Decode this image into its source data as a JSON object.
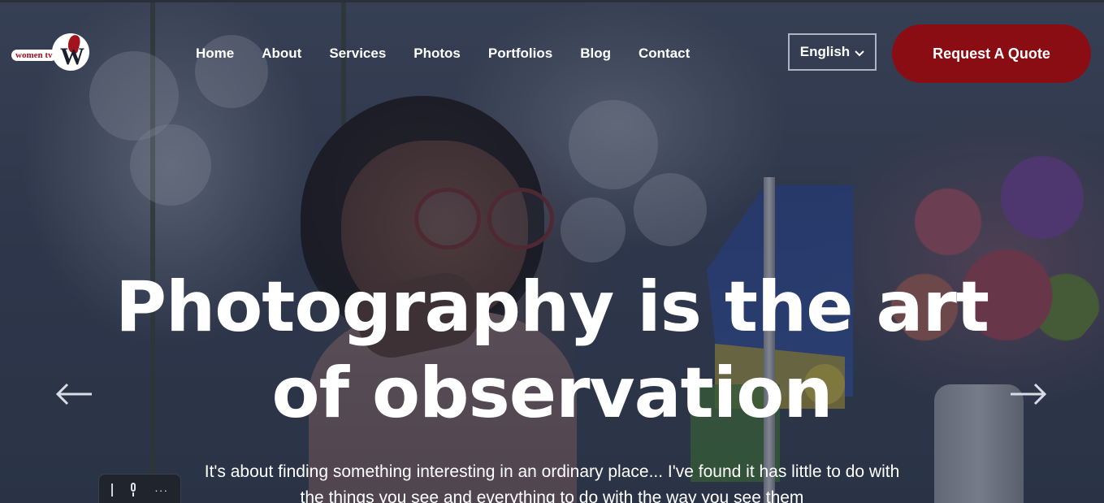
{
  "brand": {
    "logo_text": "women tv",
    "logo_letter": "W"
  },
  "nav": {
    "items": [
      {
        "label": "Home"
      },
      {
        "label": "About"
      },
      {
        "label": "Services"
      },
      {
        "label": "Photos"
      },
      {
        "label": "Portfolios"
      },
      {
        "label": "Blog"
      },
      {
        "label": "Contact"
      }
    ]
  },
  "language": {
    "selected": "English",
    "icon": "chevron-down-icon"
  },
  "cta": {
    "label": "Request A Quote",
    "color": "#8b0d14"
  },
  "hero": {
    "headline_line1": "Photography is the art",
    "headline_line2": "of observation",
    "subline_line1": "It's about finding something interesting in an ordinary place... I've found it has little to do with",
    "subline_line2": "the things you see and everything to do with the way you see them",
    "prev_icon": "arrow-left-icon",
    "next_icon": "arrow-right-icon"
  },
  "mini_toolbar": {
    "icons": [
      "grip-icon",
      "microphone-icon",
      "more-icon"
    ]
  }
}
